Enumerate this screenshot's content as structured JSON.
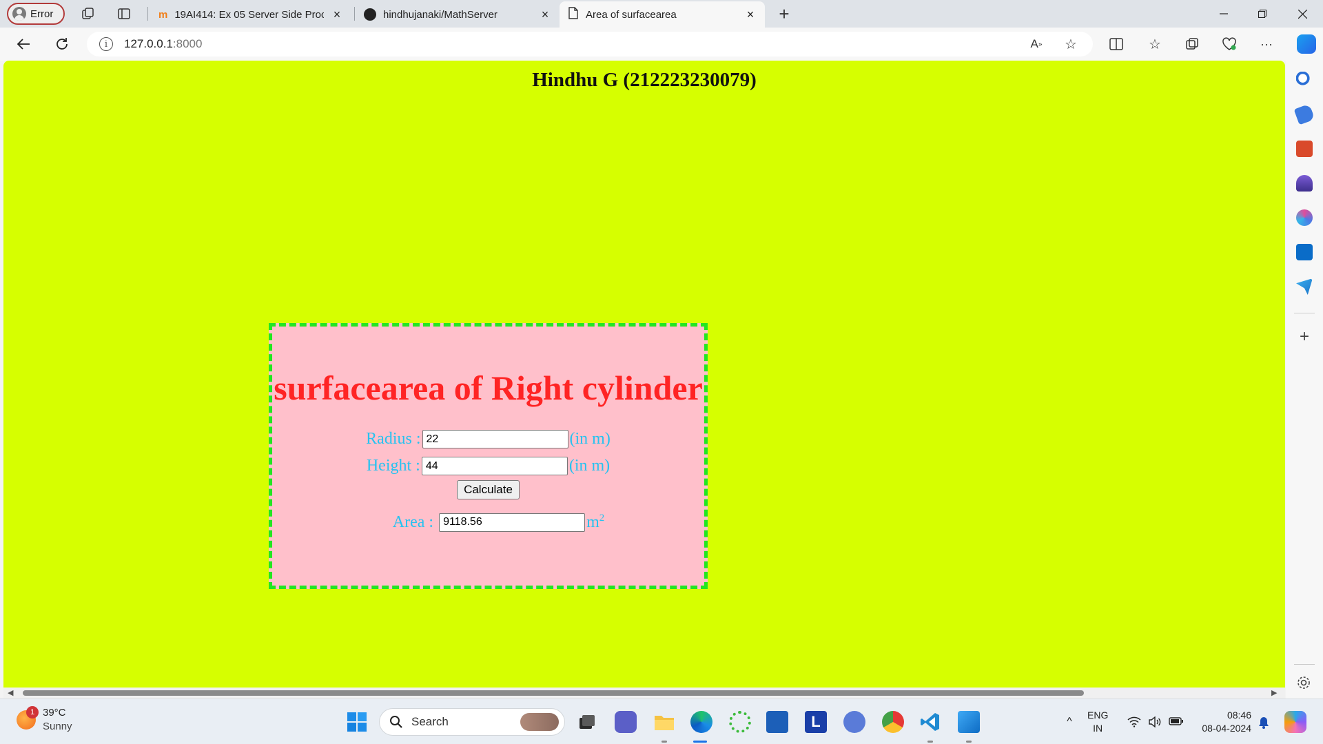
{
  "browser": {
    "profile_label": "Error",
    "tabs": [
      {
        "title": "19AI414: Ex 05 Server Side Proce",
        "close": "×"
      },
      {
        "title": "hindhujanaki/MathServer",
        "close": "×"
      },
      {
        "title": "Area of surfacearea",
        "close": "×"
      }
    ],
    "new_tab": "+",
    "url_host": "127.0.0.1",
    "url_port": ":8000"
  },
  "page": {
    "heading": "Hindhu G (212223230079)",
    "calc_title": "surfacearea of Right cylinder",
    "radius_label": "Radius :",
    "radius_value": "22",
    "radius_unit": "(in m)",
    "height_label": "Height :",
    "height_value": "44",
    "height_unit": "(in m)",
    "button_label": "Calculate",
    "area_label": "Area :",
    "area_value": "9118.56",
    "area_unit": "m",
    "area_unit_sup": "2"
  },
  "taskbar": {
    "weather_badge": "1",
    "temperature": "39°C",
    "condition": "Sunny",
    "search_placeholder": "Search",
    "lang_top": "ENG",
    "lang_bottom": "IN",
    "time": "08:46",
    "date": "08-04-2024"
  },
  "colors": {
    "page_bg": "#d6ff00",
    "box_bg": "#ffc0cb",
    "box_border": "#22e622",
    "title_color": "#ff2424",
    "label_color": "#27c2f0"
  }
}
